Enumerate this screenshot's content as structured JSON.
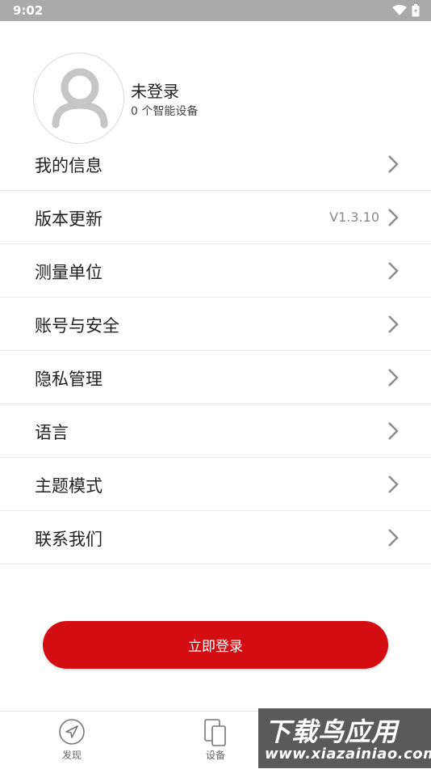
{
  "status_bar": {
    "time": "9:02"
  },
  "profile": {
    "name": "未登录",
    "devices": "0 个智能设备"
  },
  "menu": [
    {
      "label": "我的信息",
      "value": ""
    },
    {
      "label": "版本更新",
      "value": "V1.3.10"
    },
    {
      "label": "测量单位",
      "value": ""
    },
    {
      "label": "账号与安全",
      "value": ""
    },
    {
      "label": "隐私管理",
      "value": ""
    },
    {
      "label": "语言",
      "value": ""
    },
    {
      "label": "主题模式",
      "value": ""
    },
    {
      "label": "联系我们",
      "value": ""
    }
  ],
  "login_button": "立即登录",
  "tabs": [
    {
      "label": "发现",
      "icon": "compass-icon"
    },
    {
      "label": "设备",
      "icon": "devices-icon"
    }
  ],
  "watermark": {
    "line1": "下载鸟应用",
    "line2": "www.xiazainiao.com"
  },
  "colors": {
    "accent": "#d30d11",
    "status_bar": "#a9a9a9"
  }
}
